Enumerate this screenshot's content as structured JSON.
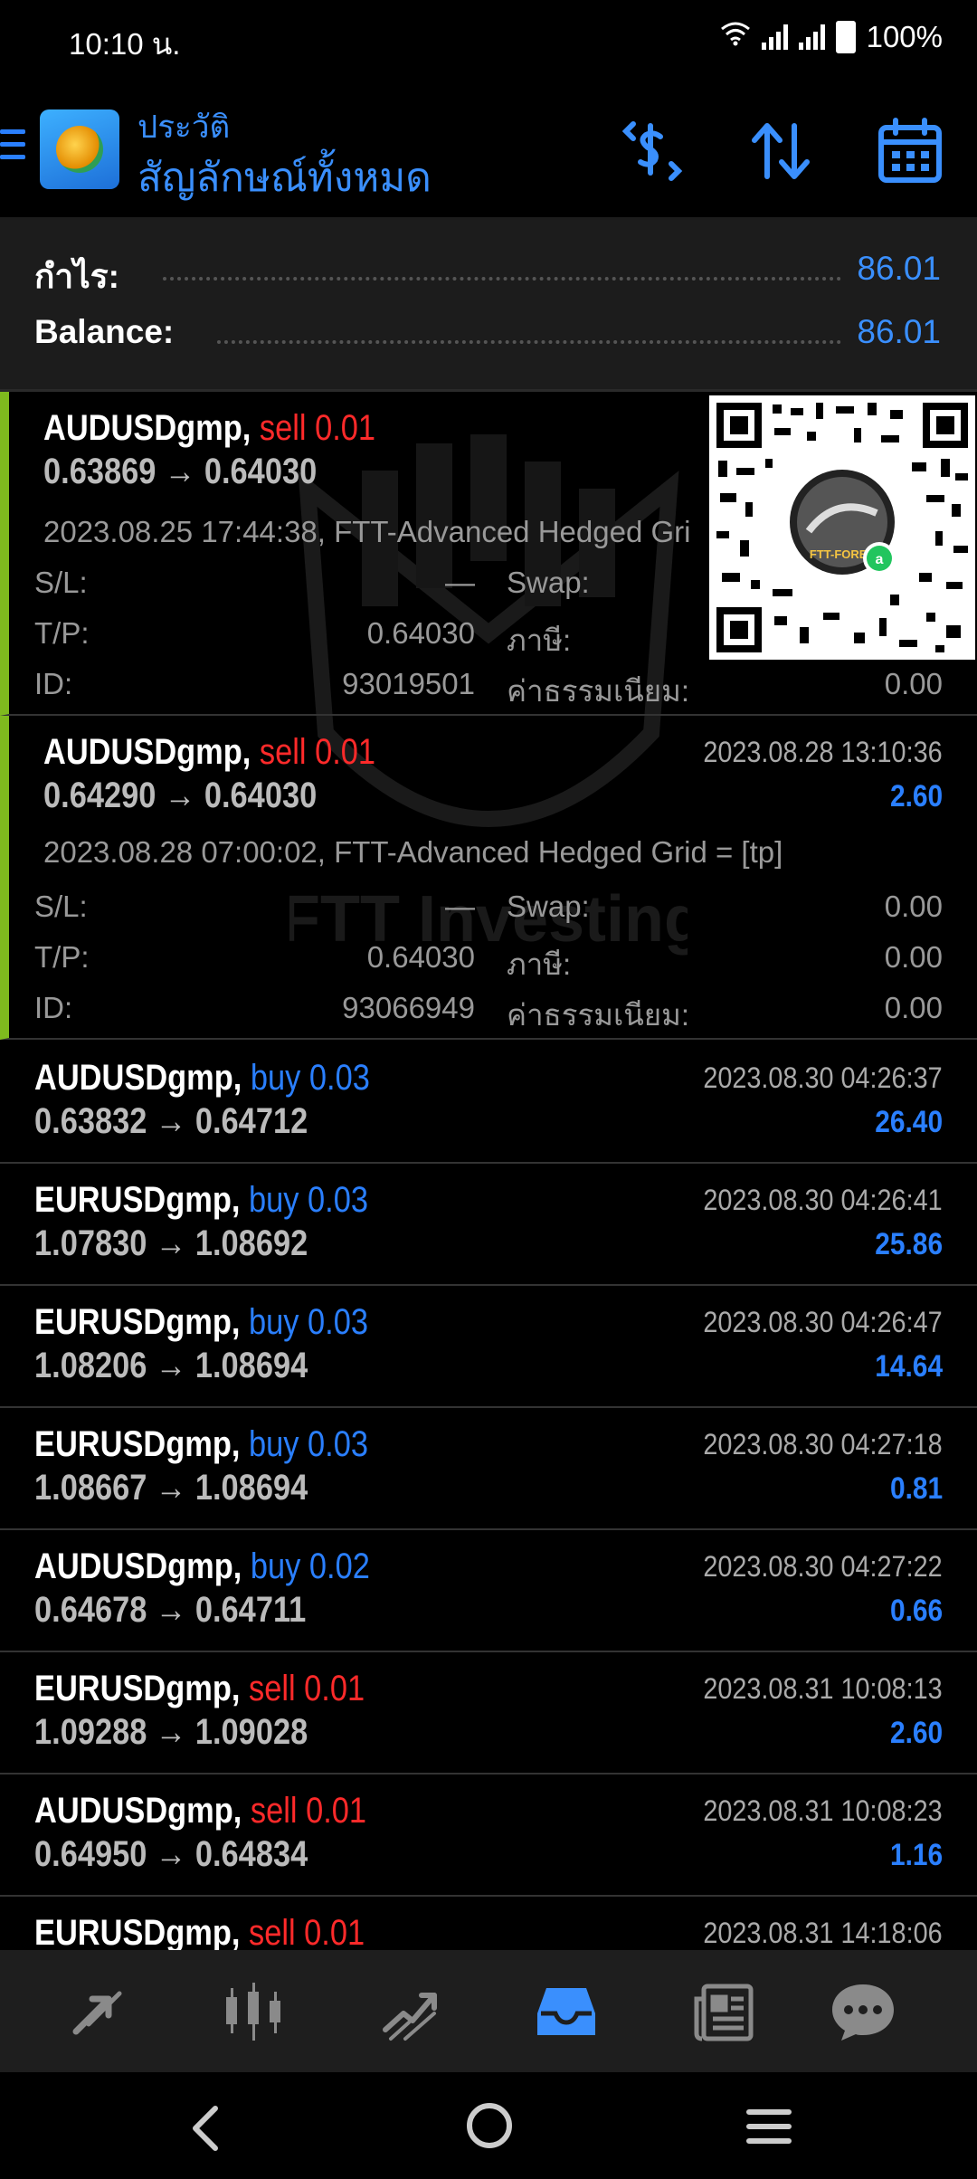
{
  "status_bar": {
    "time": "10:10 น.",
    "battery": "100%"
  },
  "header": {
    "subtitle": "ประวัติ",
    "title": "สัญลักษณ์ทั้งหมด",
    "icons": [
      "menu-icon",
      "app-logo",
      "currency-sort-icon",
      "sort-icon",
      "calendar-icon"
    ]
  },
  "summary": {
    "profit_label": "กำไร:",
    "profit_value": "86.01",
    "balance_label": "Balance:",
    "balance_value": "86.01"
  },
  "labels": {
    "sl": "S/L:",
    "tp": "T/P:",
    "id": "ID:",
    "swap": "Swap:",
    "tax": "ภาษี:",
    "commission": "ค่าธรรมเนียม:"
  },
  "deals": [
    {
      "symbol": "AUDUSDgmp,",
      "side": "sell 0.01",
      "prices": "0.63869 → 0.64030",
      "datetime": "",
      "profit": "",
      "comment": "2023.08.25 17:44:38, FTT-Advanced Hedged Gri",
      "sl": "—",
      "tp": "0.64030",
      "id": "93019501",
      "swap": "",
      "tax": "",
      "commission": "0.00"
    },
    {
      "symbol": "AUDUSDgmp,",
      "side": "sell 0.01",
      "prices": "0.64290 → 0.64030",
      "datetime": "2023.08.28 13:10:36",
      "profit": "2.60",
      "comment": "2023.08.28 07:00:02, FTT-Advanced Hedged Grid = [tp]",
      "sl": "—",
      "tp": "0.64030",
      "id": "93066949",
      "swap": "0.00",
      "tax": "0.00",
      "commission": "0.00"
    },
    {
      "symbol": "AUDUSDgmp,",
      "side": "buy 0.03",
      "prices": "0.63832 → 0.64712",
      "datetime": "2023.08.30 04:26:37",
      "profit": "26.40"
    },
    {
      "symbol": "EURUSDgmp,",
      "side": "buy 0.03",
      "prices": "1.07830 → 1.08692",
      "datetime": "2023.08.30 04:26:41",
      "profit": "25.86"
    },
    {
      "symbol": "EURUSDgmp,",
      "side": "buy 0.03",
      "prices": "1.08206 → 1.08694",
      "datetime": "2023.08.30 04:26:47",
      "profit": "14.64"
    },
    {
      "symbol": "EURUSDgmp,",
      "side": "buy 0.03",
      "prices": "1.08667 → 1.08694",
      "datetime": "2023.08.30 04:27:18",
      "profit": "0.81"
    },
    {
      "symbol": "AUDUSDgmp,",
      "side": "buy 0.02",
      "prices": "0.64678 → 0.64711",
      "datetime": "2023.08.30 04:27:22",
      "profit": "0.66"
    },
    {
      "symbol": "EURUSDgmp,",
      "side": "sell 0.01",
      "prices": "1.09288 → 1.09028",
      "datetime": "2023.08.31 10:08:13",
      "profit": "2.60"
    },
    {
      "symbol": "AUDUSDgmp,",
      "side": "sell 0.01",
      "prices": "0.64950 → 0.64834",
      "datetime": "2023.08.31 10:08:23",
      "profit": "1.16"
    },
    {
      "symbol": "EURUSDgmp,",
      "side": "sell 0.01",
      "prices": "",
      "datetime": "2023.08.31 14:18:06",
      "profit": ""
    }
  ],
  "watermark": {
    "text": "FTT Investing"
  },
  "qr_overlay": {
    "badge_text": "FTT-FOREX"
  },
  "bottom_nav": {
    "items": [
      "quotes-icon",
      "chart-icon",
      "trade-icon",
      "history-icon",
      "news-icon",
      "chat-icon"
    ],
    "active_index": 3
  },
  "colors": {
    "accent": "#3a8ffd",
    "sell": "#ff2a2a",
    "buy": "#2a7fff",
    "expanded_bar": "#7fba1e"
  }
}
